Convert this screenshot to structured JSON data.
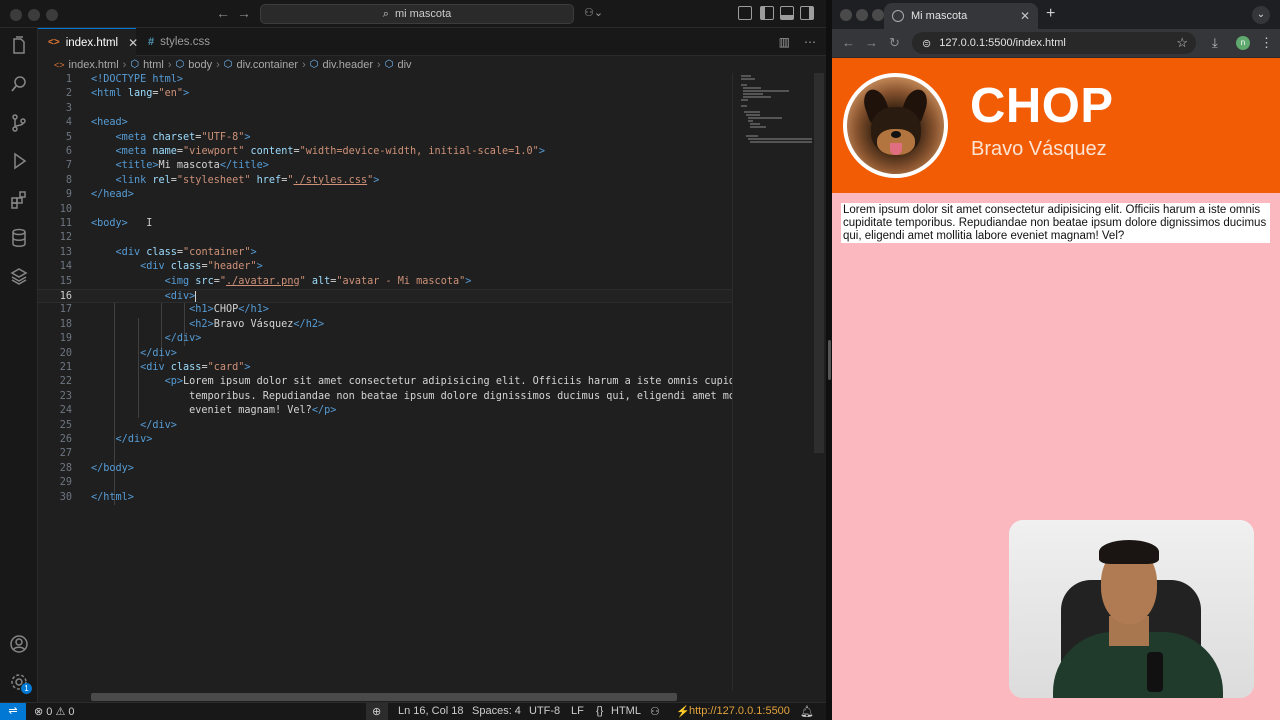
{
  "vscode": {
    "search_text": "mi mascota",
    "tabs": [
      {
        "label": "index.html",
        "icon": "html-file-icon",
        "active": true,
        "close": "✕"
      },
      {
        "label": "styles.css",
        "icon": "css-file-icon",
        "active": false
      }
    ],
    "breadcrumb": [
      "index.html",
      "html",
      "body",
      "div.container",
      "div.header",
      "div"
    ],
    "code_lines": [
      {
        "n": "1"
      },
      {
        "n": "2"
      },
      {
        "n": "3"
      },
      {
        "n": "4"
      },
      {
        "n": "5"
      },
      {
        "n": "6"
      },
      {
        "n": "7"
      },
      {
        "n": "8"
      },
      {
        "n": "9"
      },
      {
        "n": "10"
      },
      {
        "n": "11"
      },
      {
        "n": "12"
      },
      {
        "n": "13"
      },
      {
        "n": "14"
      },
      {
        "n": "15"
      },
      {
        "n": "16"
      },
      {
        "n": "17"
      },
      {
        "n": "18"
      },
      {
        "n": "19"
      },
      {
        "n": "20"
      },
      {
        "n": "21"
      },
      {
        "n": "22"
      },
      {
        "n": "23"
      },
      {
        "n": "24"
      },
      {
        "n": "25"
      },
      {
        "n": "26"
      },
      {
        "n": "27"
      },
      {
        "n": "28"
      },
      {
        "n": "29"
      },
      {
        "n": "30"
      }
    ],
    "code": {
      "l1_tag": "<!DOCTYPE html>",
      "l2_tag": "<html",
      "l2_attr": "lang",
      "l2_val": "\"en\"",
      "l4": "<head>",
      "l5_attr": "charset",
      "l5_val": "\"UTF-8\"",
      "l6_attr1": "name",
      "l6_val1": "\"viewport\"",
      "l6_attr2": "content",
      "l6_val2": "\"width=device-width, initial-scale=1.0\"",
      "l7_text": "Mi mascota",
      "l8_attr1": "rel",
      "l8_val1": "\"stylesheet\"",
      "l8_attr2": "href",
      "l8_val2": "./styles.css",
      "l9": "</head>",
      "l11": "<body>",
      "l13_val": "\"container\"",
      "l14_val": "\"header\"",
      "l15_attr1": "src",
      "l15_val1": "./avatar.png",
      "l15_attr2": "alt",
      "l15_val2": "\"avatar - Mi mascota\"",
      "l17_text": "CHOP",
      "l18_text": "Bravo Vásquez",
      "l21_val": "\"card\"",
      "l22_text": "Lorem ipsum dolor sit amet consectetur adipisicing elit. Officiis harum a iste omnis cupiditate",
      "l23_text": "temporibus. Repudiandae non beatae ipsum dolore dignissimos ducimus qui, eligendi amet mollitia",
      "l24_text": "eveniet magnam! Vel?",
      "l28": "</body>",
      "l30": "</html>"
    },
    "status": {
      "errors": "0",
      "warnings": "0",
      "position": "Ln 16, Col 18",
      "spaces": "Spaces: 4",
      "encoding": "UTF-8",
      "eol": "LF",
      "language": "HTML",
      "live_server": "http://127.0.0.1:5500",
      "accounts_badge": "1"
    }
  },
  "browser": {
    "tab_title": "Mi mascota",
    "url": "127.0.0.1:5500/index.html",
    "profile_initial": "n",
    "page": {
      "h1": "CHOP",
      "h2": "Bravo Vásquez",
      "paragraph": "Lorem ipsum dolor sit amet consectetur adipisicing elit. Officiis harum a iste omnis cupiditate temporibus. Repudiandae non beatae ipsum dolore dignissimos ducimus qui, eligendi amet mollitia labore eveniet magnam! Vel?",
      "avatar_alt": "avatar - Mi mascota"
    }
  },
  "colors": {
    "header_bg": "#f25c05",
    "page_bg": "#fbb9bf",
    "accent": "#0078d4"
  }
}
